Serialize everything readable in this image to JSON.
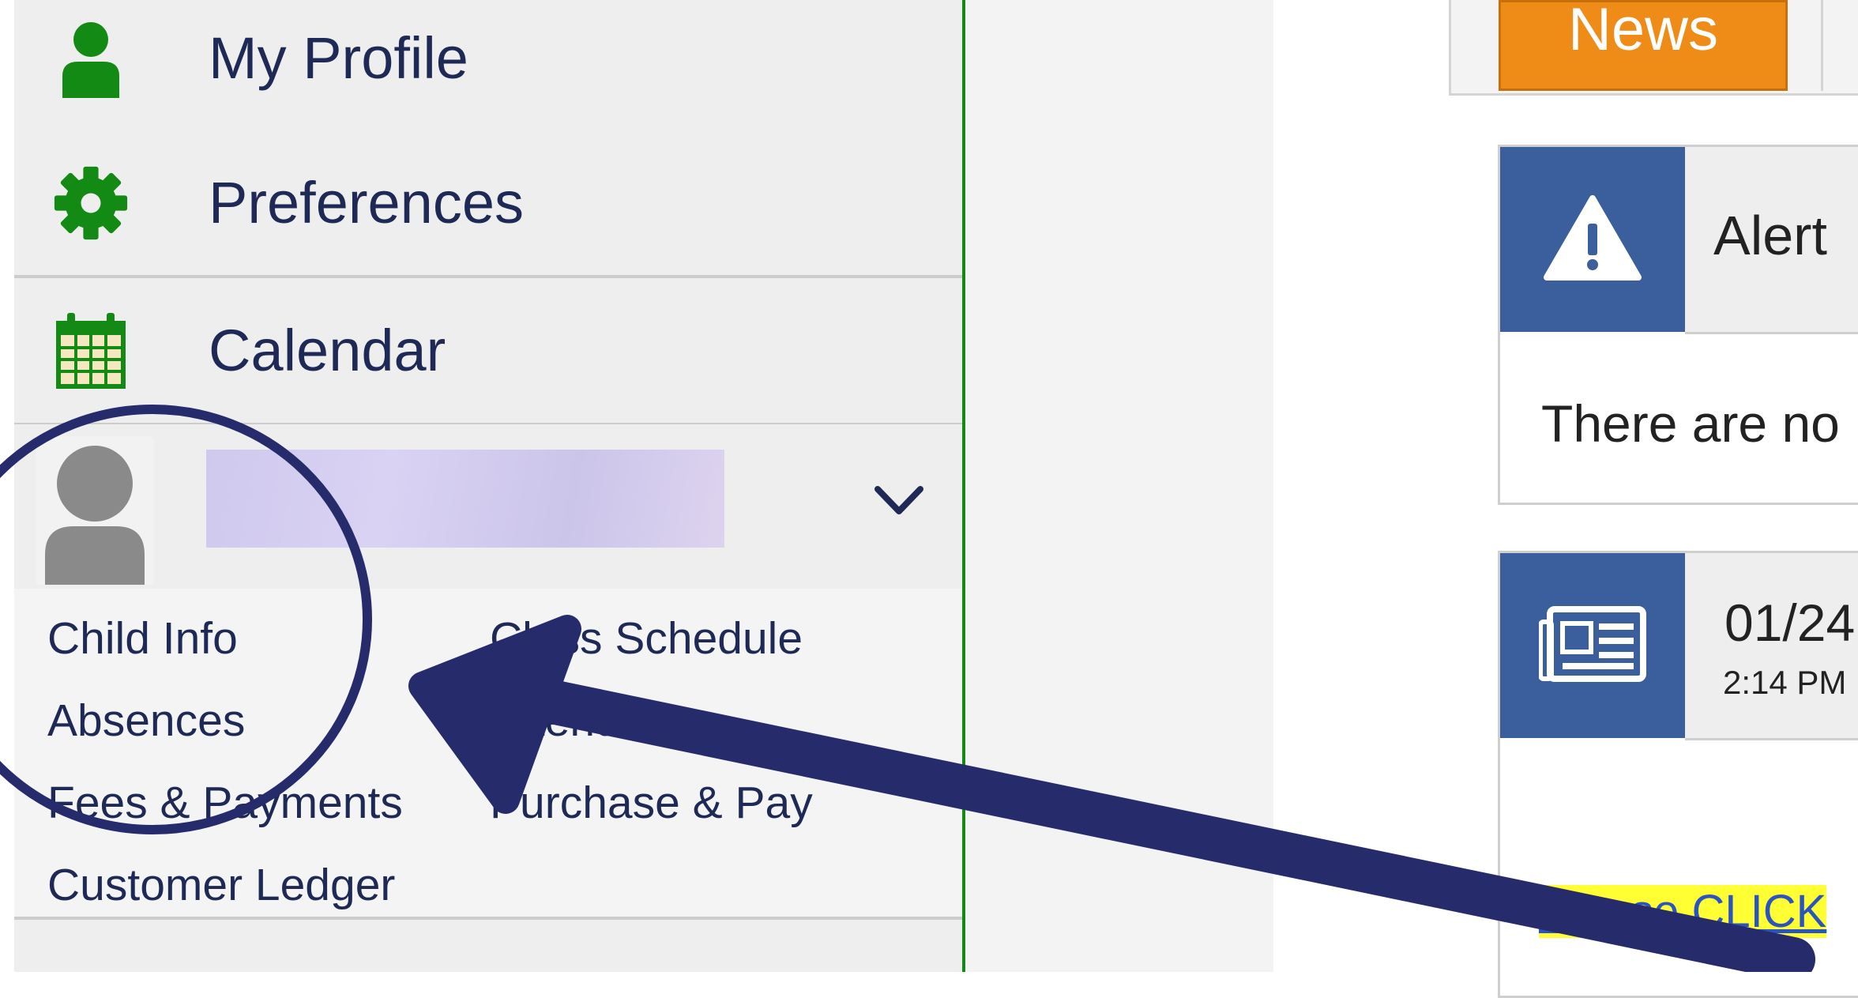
{
  "sidebar": {
    "items": [
      {
        "label": "My Profile",
        "icon": "user-icon"
      },
      {
        "label": "Preferences",
        "icon": "gear-icon"
      },
      {
        "label": "Calendar",
        "icon": "calendar-icon"
      }
    ],
    "child": {
      "links": [
        "Child Info",
        "Class Schedule",
        "Absences",
        "Attendance",
        "Fees & Payments",
        "Purchase & Pay",
        "Customer Ledger"
      ]
    }
  },
  "main": {
    "tab": {
      "label": "News"
    },
    "alert_card": {
      "title": "Alert",
      "body": "There are no"
    },
    "news_card": {
      "date": "01/24",
      "time": "2:14 PM",
      "link": "Please CLICK"
    }
  },
  "colors": {
    "nav_text": "#1e2a55",
    "icon_green": "#138a13",
    "tab_orange": "#ef8b17",
    "card_blue": "#3b5f9c",
    "annotation_navy": "#262b6b",
    "link_highlight": "#ffff33"
  }
}
